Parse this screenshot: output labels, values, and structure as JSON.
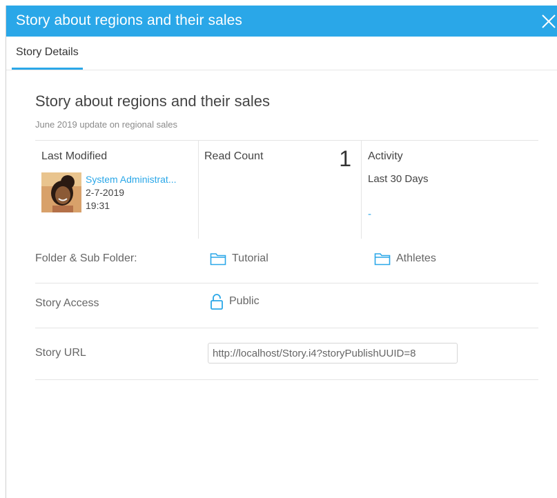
{
  "dialog": {
    "title": "Story about regions and their sales",
    "close_icon": "close-icon"
  },
  "tabs": [
    {
      "label": "Story Details",
      "active": true
    }
  ],
  "story": {
    "title": "Story about regions and their sales",
    "description": "June 2019 update on regional sales"
  },
  "stats": {
    "last_modified": {
      "label": "Last Modified",
      "user": "System Administrat...",
      "date": "2-7-2019",
      "time": "19:31"
    },
    "read_count": {
      "label": "Read Count",
      "value": "1"
    },
    "activity": {
      "label": "Activity",
      "period": "Last 30 Days",
      "value": "-"
    }
  },
  "details": {
    "folder": {
      "label": "Folder & Sub Folder:",
      "folder_name": "Tutorial",
      "subfolder_name": "Athletes",
      "icon": "folder-icon"
    },
    "access": {
      "label": "Story Access",
      "value": "Public",
      "icon": "unlock-icon"
    },
    "url": {
      "label": "Story URL",
      "value": "http://localhost/Story.i4?storyPublishUUID=8"
    }
  },
  "colors": {
    "accent": "#2aa7e8",
    "text": "#444444",
    "muted": "#8a8a8a",
    "divider": "#e4e4e4"
  }
}
